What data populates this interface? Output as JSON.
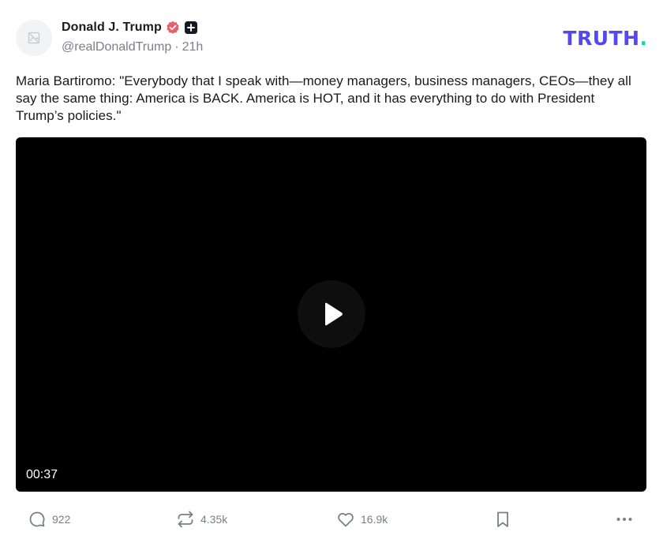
{
  "author": {
    "display_name": "Donald J. Trump",
    "handle": "@realDonaldTrump",
    "separator": "·",
    "time_ago": "21h",
    "verified_icon": "verified-badge-icon",
    "verified_color": "#e8616a",
    "plus_icon": "plus-badge-icon"
  },
  "brand": {
    "logo_text": "TRUTH",
    "logo_dot": ".",
    "primary_color": "#5448ee",
    "accent_color": "#0cd3b0"
  },
  "post": {
    "text": "Maria Bartiromo: \"Everybody that I speak with—money managers, business managers, CEOs—they all say the same thing: America is BACK. America is HOT, and it has everything to do with President Trump’s policies.\""
  },
  "video": {
    "duration": "00:37",
    "play_icon": "play-icon"
  },
  "actions": {
    "replies": "922",
    "reposts": "4.35k",
    "likes": "16.9k",
    "reply_icon": "comment-icon",
    "repost_icon": "repost-icon",
    "like_icon": "heart-icon",
    "bookmark_icon": "bookmark-icon",
    "more_icon": "more-icon"
  }
}
